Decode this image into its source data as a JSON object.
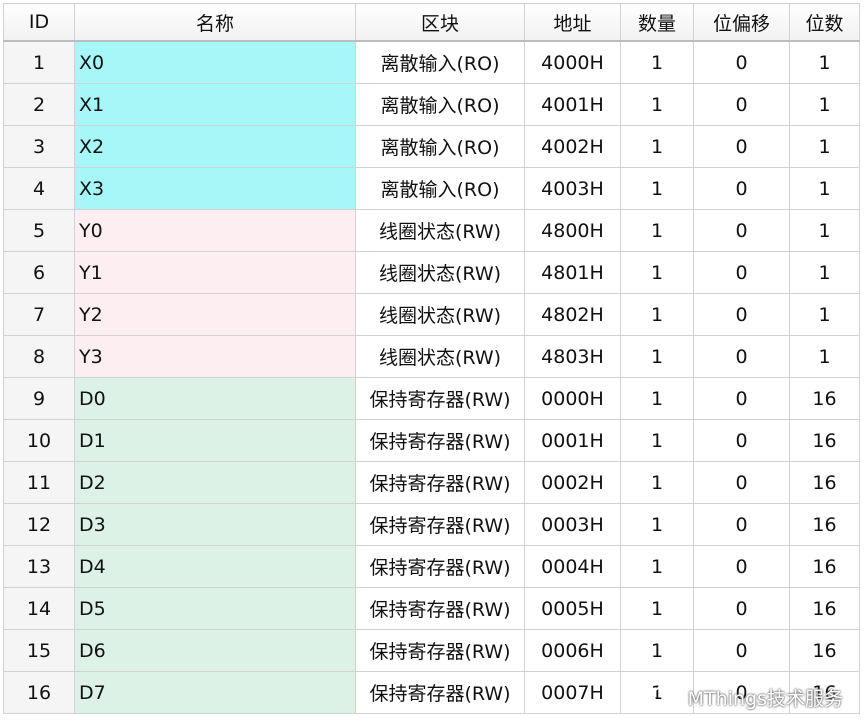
{
  "columns": [
    "ID",
    "名称",
    "区块",
    "地址",
    "数量",
    "位偏移",
    "位数"
  ],
  "rows": [
    {
      "id": "1",
      "name": "X0",
      "block": "离散输入(RO)",
      "addr": "4000H",
      "count": "1",
      "offset": "0",
      "bits": "1"
    },
    {
      "id": "2",
      "name": "X1",
      "block": "离散输入(RO)",
      "addr": "4001H",
      "count": "1",
      "offset": "0",
      "bits": "1"
    },
    {
      "id": "3",
      "name": "X2",
      "block": "离散输入(RO)",
      "addr": "4002H",
      "count": "1",
      "offset": "0",
      "bits": "1"
    },
    {
      "id": "4",
      "name": "X3",
      "block": "离散输入(RO)",
      "addr": "4003H",
      "count": "1",
      "offset": "0",
      "bits": "1"
    },
    {
      "id": "5",
      "name": "Y0",
      "block": "线圈状态(RW)",
      "addr": "4800H",
      "count": "1",
      "offset": "0",
      "bits": "1"
    },
    {
      "id": "6",
      "name": "Y1",
      "block": "线圈状态(RW)",
      "addr": "4801H",
      "count": "1",
      "offset": "0",
      "bits": "1"
    },
    {
      "id": "7",
      "name": "Y2",
      "block": "线圈状态(RW)",
      "addr": "4802H",
      "count": "1",
      "offset": "0",
      "bits": "1"
    },
    {
      "id": "8",
      "name": "Y3",
      "block": "线圈状态(RW)",
      "addr": "4803H",
      "count": "1",
      "offset": "0",
      "bits": "1"
    },
    {
      "id": "9",
      "name": "D0",
      "block": "保持寄存器(RW)",
      "addr": "0000H",
      "count": "1",
      "offset": "0",
      "bits": "16"
    },
    {
      "id": "10",
      "name": "D1",
      "block": "保持寄存器(RW)",
      "addr": "0001H",
      "count": "1",
      "offset": "0",
      "bits": "16"
    },
    {
      "id": "11",
      "name": "D2",
      "block": "保持寄存器(RW)",
      "addr": "0002H",
      "count": "1",
      "offset": "0",
      "bits": "16"
    },
    {
      "id": "12",
      "name": "D3",
      "block": "保持寄存器(RW)",
      "addr": "0003H",
      "count": "1",
      "offset": "0",
      "bits": "16"
    },
    {
      "id": "13",
      "name": "D4",
      "block": "保持寄存器(RW)",
      "addr": "0004H",
      "count": "1",
      "offset": "0",
      "bits": "16"
    },
    {
      "id": "14",
      "name": "D5",
      "block": "保持寄存器(RW)",
      "addr": "0005H",
      "count": "1",
      "offset": "0",
      "bits": "16"
    },
    {
      "id": "15",
      "name": "D6",
      "block": "保持寄存器(RW)",
      "addr": "0006H",
      "count": "1",
      "offset": "0",
      "bits": "16"
    },
    {
      "id": "16",
      "name": "D7",
      "block": "保持寄存器(RW)",
      "addr": "0007H",
      "count": "1",
      "offset": "0",
      "bits": "16"
    }
  ],
  "name_colors": {
    "X": "#a6f7f7",
    "Y": "#fdeff1",
    "D": "#dcf2e7"
  },
  "watermark": {
    "icon": "wechat-icon",
    "text": "MThings技术服务"
  }
}
